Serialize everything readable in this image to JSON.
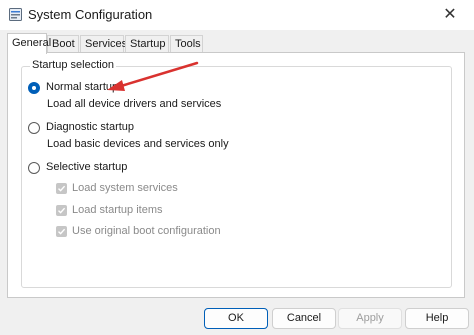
{
  "window": {
    "title": "System Configuration",
    "close_glyph": "✕"
  },
  "tabs": [
    {
      "label": "General",
      "active": true
    },
    {
      "label": "Boot",
      "active": false
    },
    {
      "label": "Services",
      "active": false
    },
    {
      "label": "Startup",
      "active": false
    },
    {
      "label": "Tools",
      "active": false
    }
  ],
  "startup_selection": {
    "group_label": "Startup selection",
    "normal": {
      "label": "Normal startup",
      "description": "Load all device drivers and services",
      "selected": true
    },
    "diagnostic": {
      "label": "Diagnostic startup",
      "description": "Load basic devices and services only",
      "selected": false
    },
    "selective": {
      "label": "Selective startup",
      "selected": false
    },
    "selective_options": [
      {
        "label": "Load system services",
        "checked": true,
        "enabled": false
      },
      {
        "label": "Load startup items",
        "checked": true,
        "enabled": false
      },
      {
        "label": "Use original boot configuration",
        "checked": true,
        "enabled": false
      }
    ]
  },
  "buttons": {
    "ok": "OK",
    "cancel": "Cancel",
    "apply": "Apply",
    "help": "Help"
  },
  "colors": {
    "accent": "#005fb8",
    "annotation_arrow": "#d9322f"
  },
  "icons": {
    "app": "system-configuration-icon",
    "close": "close-icon"
  }
}
